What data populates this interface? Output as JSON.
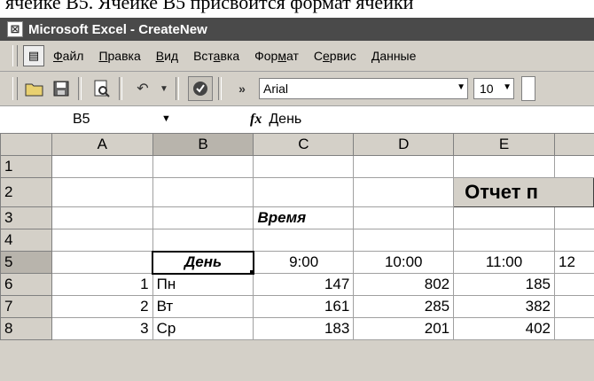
{
  "doc_text": "ячейке B5. Ячейке B5 присвоится формат ячейки",
  "window": {
    "title": "Microsoft Excel - CreateNew"
  },
  "menu": {
    "items": [
      {
        "pre": "",
        "u": "Ф",
        "post": "айл"
      },
      {
        "pre": "",
        "u": "П",
        "post": "равка"
      },
      {
        "pre": "",
        "u": "В",
        "post": "ид"
      },
      {
        "pre": "Вст",
        "u": "а",
        "post": "вка"
      },
      {
        "pre": "Фор",
        "u": "м",
        "post": "ат"
      },
      {
        "pre": "С",
        "u": "е",
        "post": "рвис"
      },
      {
        "pre": "",
        "u": "Д",
        "post": "анные"
      }
    ]
  },
  "toolbar": {
    "font": "Arial",
    "size": "10",
    "overflow": "»"
  },
  "formula": {
    "cell_ref": "B5",
    "fx": "fx",
    "value": "День"
  },
  "grid": {
    "columns": [
      "A",
      "B",
      "C",
      "D",
      "E",
      ""
    ],
    "active_column": "B",
    "active_row": "5",
    "rows": [
      {
        "n": "1",
        "a": "",
        "b": "",
        "c": "",
        "d": "",
        "e": "",
        "f": ""
      },
      {
        "n": "2",
        "a": "",
        "b": "",
        "c": "",
        "title": "Отчет п"
      },
      {
        "n": "3",
        "a": "",
        "b": "",
        "c": "Время",
        "d": "",
        "e": "",
        "f": ""
      },
      {
        "n": "4",
        "a": "",
        "b": "",
        "c": "",
        "d": "",
        "e": "",
        "f": ""
      },
      {
        "n": "5",
        "a": "",
        "b": "День",
        "c": "9:00",
        "d": "10:00",
        "e": "11:00",
        "f": "12"
      },
      {
        "n": "6",
        "a": "1",
        "b": "Пн",
        "c": "147",
        "d": "802",
        "e": "185",
        "f": ""
      },
      {
        "n": "7",
        "a": "2",
        "b": "Вт",
        "c": "161",
        "d": "285",
        "e": "382",
        "f": ""
      },
      {
        "n": "8",
        "a": "3",
        "b": "Ср",
        "c": "183",
        "d": "201",
        "e": "402",
        "f": ""
      }
    ]
  }
}
